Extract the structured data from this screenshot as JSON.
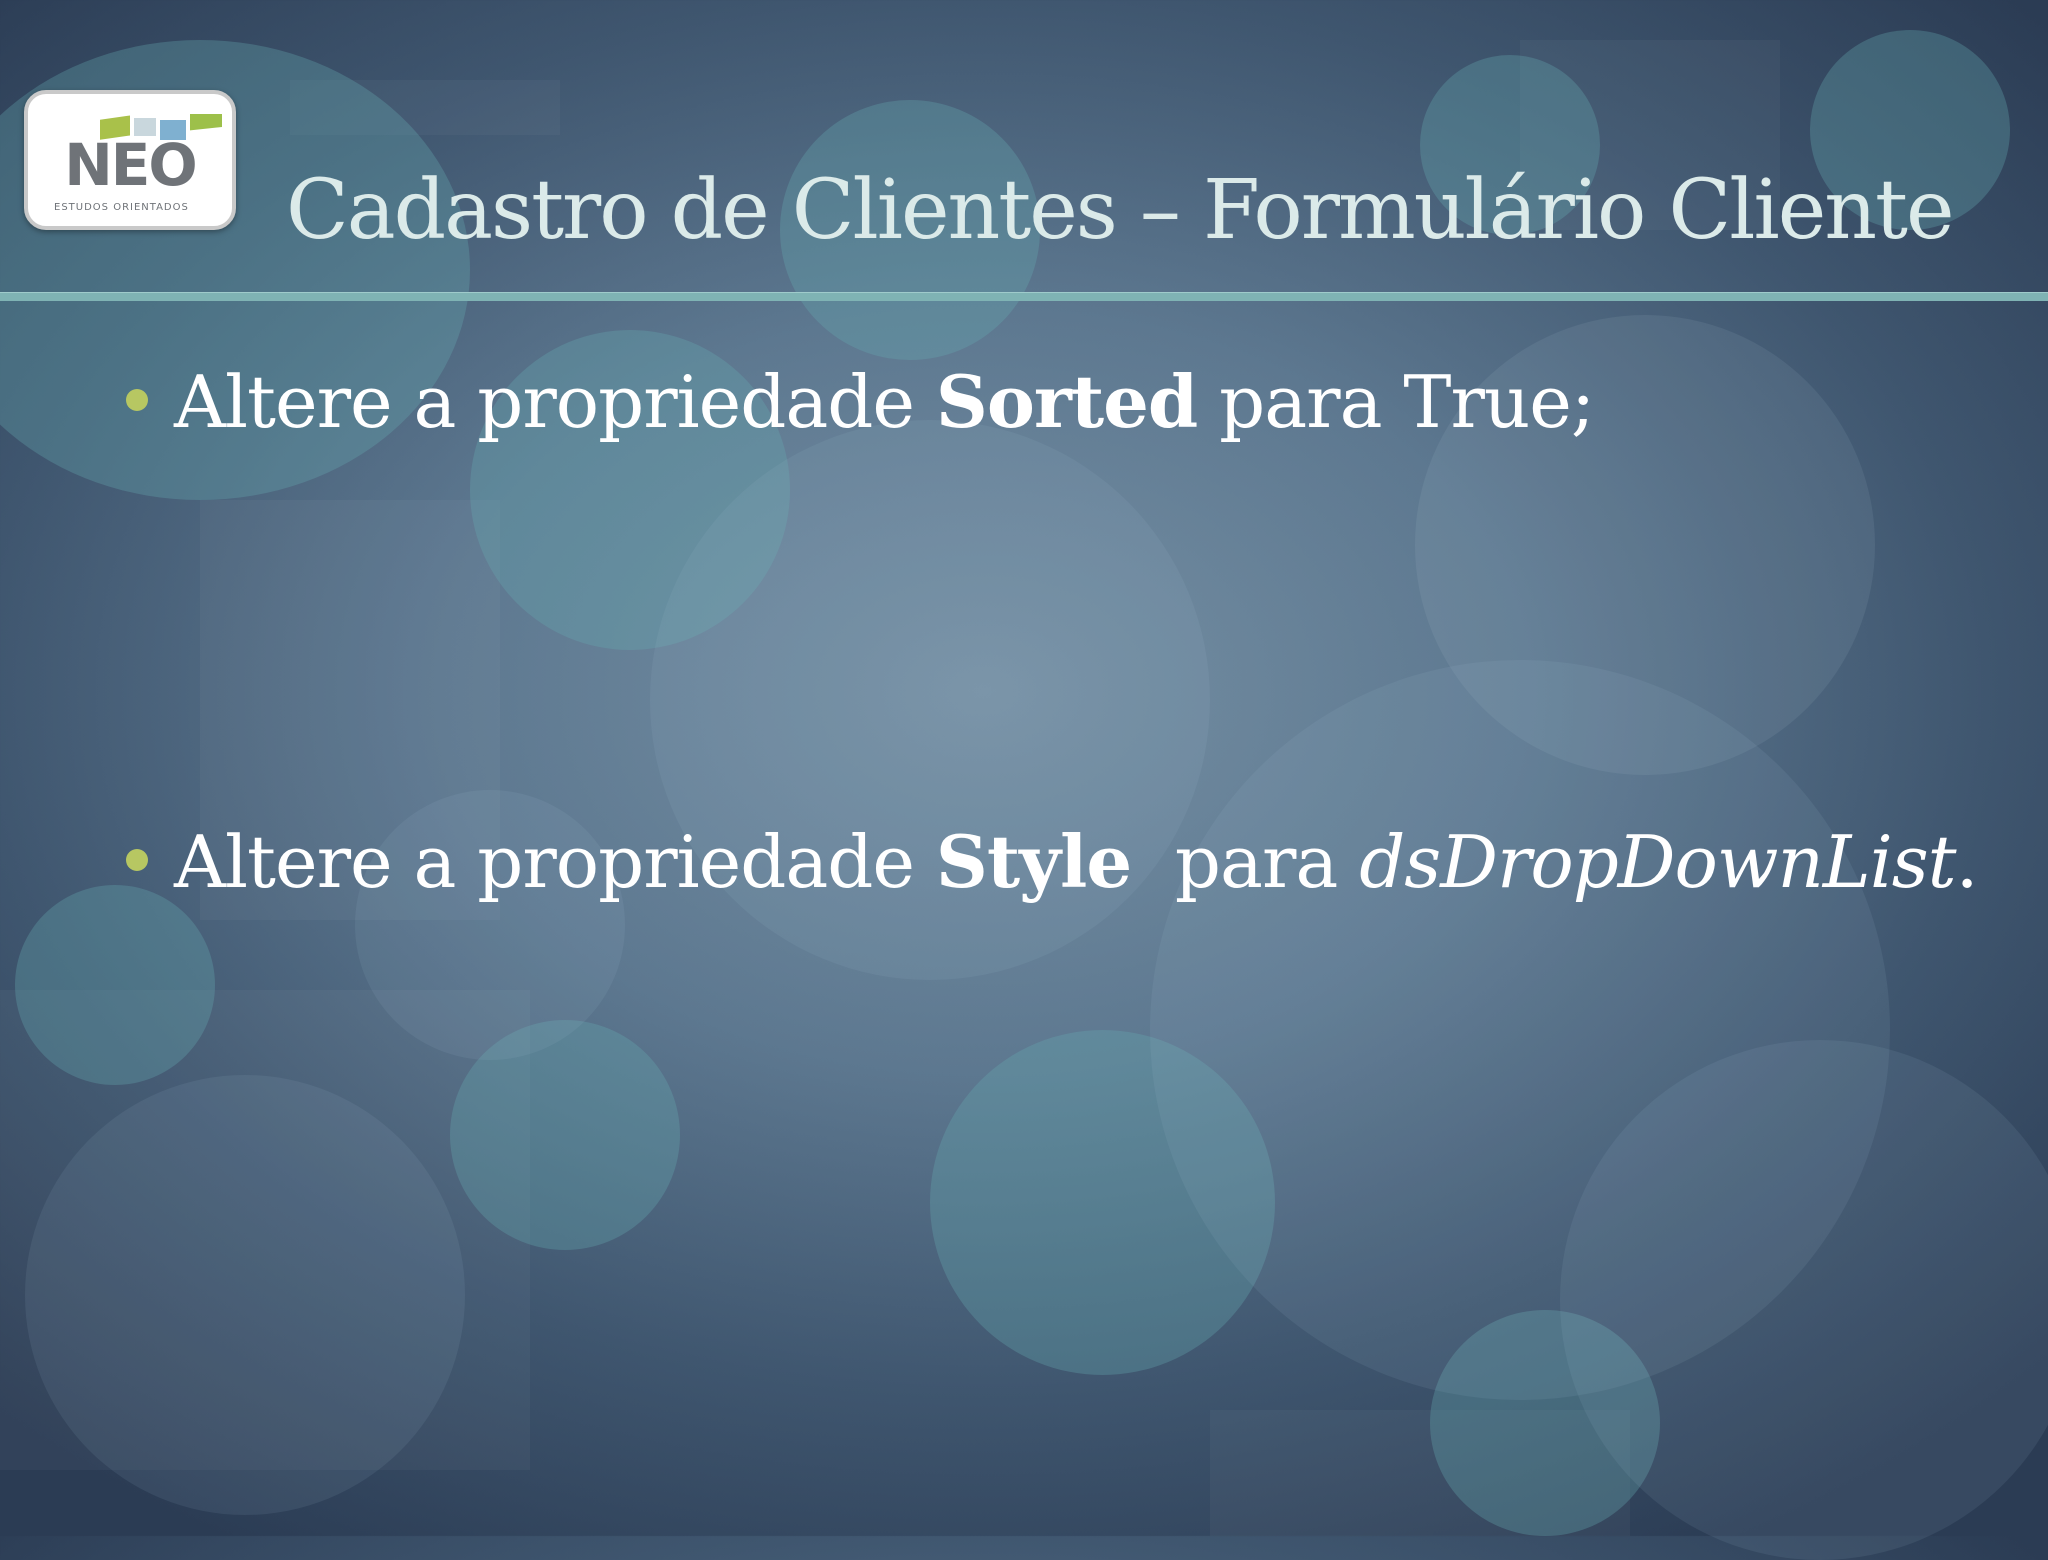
{
  "slide": {
    "title": "Cadastro de Clientes – Formulário Cliente",
    "logo": {
      "word": "NEO",
      "tagline": "ESTUDOS ORIENTADOS"
    },
    "bullets": [
      {
        "pre": "Altere a propriedade ",
        "bold": "Sorted",
        "mid": " para True;",
        "italic": "",
        "post": ""
      },
      {
        "pre": "Altere a propriedade ",
        "bold": "Style",
        "mid": "  para ",
        "italic": "dsDropDownList",
        "post": "."
      }
    ]
  },
  "colors": {
    "title": "#dbeae9",
    "rule": "#7fb3b4",
    "bullet_dot": "#b7c762",
    "body_text": "#ffffff"
  }
}
